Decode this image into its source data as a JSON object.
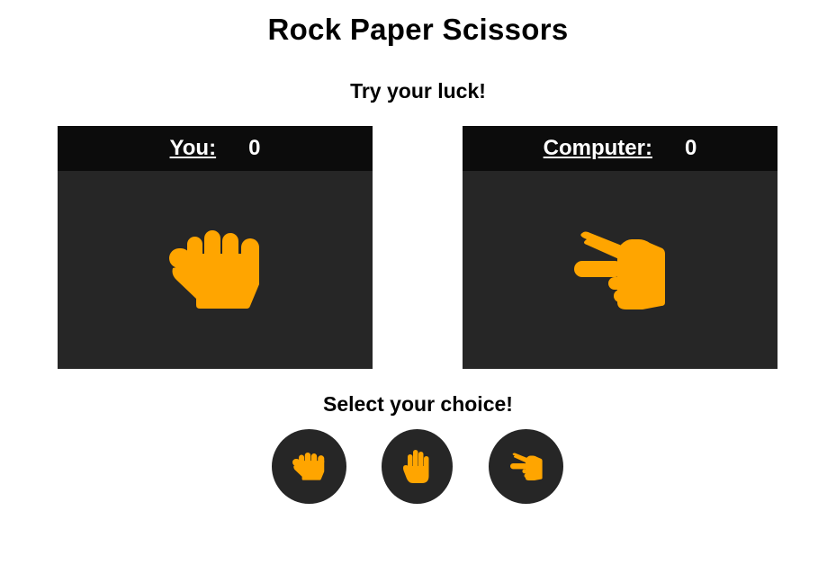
{
  "page": {
    "title": "Rock Paper Scissors",
    "subtitle": "Try your luck!",
    "select_prompt": "Select your choice!"
  },
  "players": {
    "you": {
      "label": "You:",
      "score": "0",
      "hand_icon": "rock-hand-icon"
    },
    "computer": {
      "label": "Computer:",
      "score": "0",
      "hand_icon": "scissors-hand-icon"
    }
  },
  "choices": [
    {
      "name": "rock",
      "icon": "rock-hand-icon"
    },
    {
      "name": "paper",
      "icon": "paper-hand-icon"
    },
    {
      "name": "scissors",
      "icon": "scissors-hand-icon"
    }
  ],
  "colors": {
    "accent": "#FFA500",
    "panel": "#262626",
    "panel_header": "#0C0C0C"
  }
}
